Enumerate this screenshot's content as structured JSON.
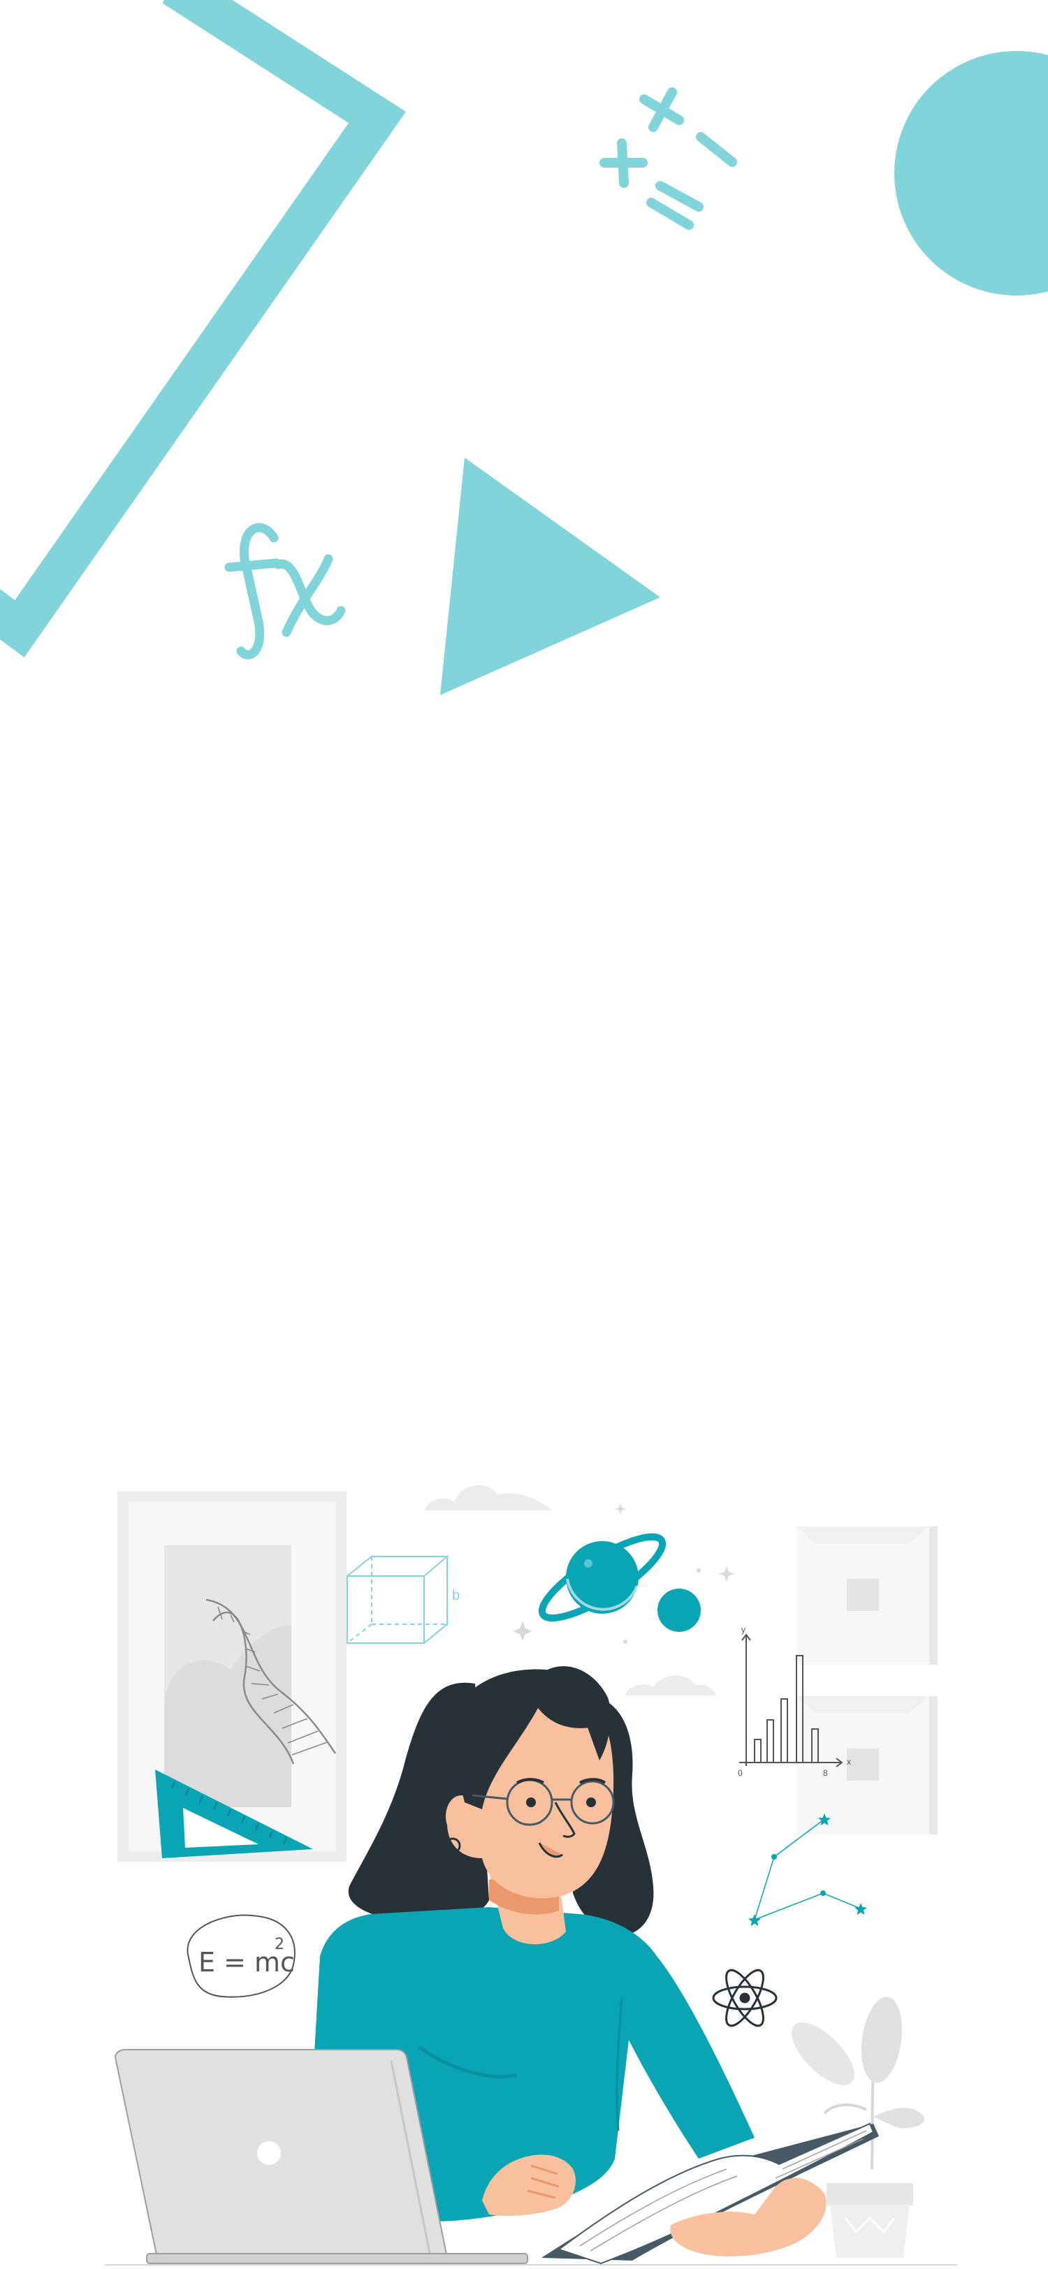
{
  "colors": {
    "accent": "#81d4da",
    "teal_dark": "#0aa5b5",
    "hair": "#263238",
    "skin": "#f9c09d",
    "skin_shadow": "#e9996b",
    "laptop": "#e0e0e0",
    "laptop_dark": "#c7c7c7",
    "book": "#455a64",
    "wall_frame": "#f2f2f2",
    "line_gray": "#9e9e9e"
  },
  "background_icons": {
    "top": [
      "bracket-shape",
      "math-operators-icon",
      "circle-shape",
      "function-fx-icon",
      "triangle-shape"
    ],
    "bottom": [
      "dna-icon",
      "triangle-ruler-icon",
      "cube-icon",
      "planet-icon",
      "moon-icon",
      "bar-chart-icon",
      "constellation-icon",
      "atom-icon",
      "plant-icon",
      "laptop-icon",
      "book-icon"
    ]
  },
  "illustration": {
    "formula_parts": {
      "base": "E = mc",
      "exponent": "2"
    },
    "cube_label": "b",
    "chart_sketch": {
      "y_label": "y",
      "x_label": "x",
      "origin": "0",
      "x_tick": "8"
    }
  }
}
